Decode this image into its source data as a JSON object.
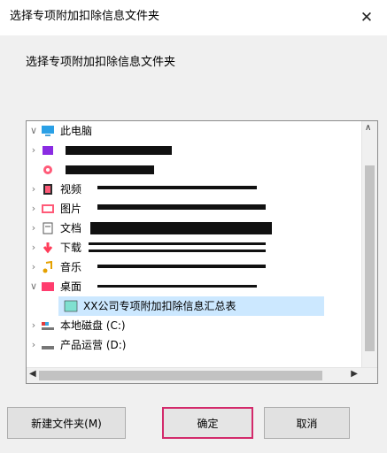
{
  "window": {
    "title": "选择专项附加扣除信息文件夹",
    "close_label": "✕"
  },
  "dialog": {
    "description": "选择专项附加扣除信息文件夹"
  },
  "tree": {
    "items": [
      {
        "label": "此电脑",
        "expanded": true,
        "icon": "computer-icon"
      },
      {
        "label": "",
        "icon": "3d-objects-icon"
      },
      {
        "label": "",
        "icon": "cloud-icon"
      },
      {
        "label": "视频",
        "icon": "video-icon"
      },
      {
        "label": "图片",
        "icon": "picture-icon"
      },
      {
        "label": "文档",
        "icon": "document-icon"
      },
      {
        "label": "下载",
        "icon": "download-icon"
      },
      {
        "label": "音乐",
        "icon": "music-icon"
      },
      {
        "label": "桌面",
        "expanded": true,
        "icon": "desktop-icon"
      },
      {
        "label": "XX公司专项附加扣除信息汇总表",
        "selected": true,
        "icon": "folder-icon"
      },
      {
        "label": "本地磁盘 (C:)",
        "icon": "drive-icon"
      },
      {
        "label": "产品运营 (D:)",
        "icon": "drive-icon"
      }
    ],
    "colors": {
      "selection_bg": "#cce8ff",
      "accent": "#d32a6b"
    }
  },
  "buttons": {
    "new_folder": "新建文件夹(M)",
    "ok": "确定",
    "cancel": "取消"
  }
}
